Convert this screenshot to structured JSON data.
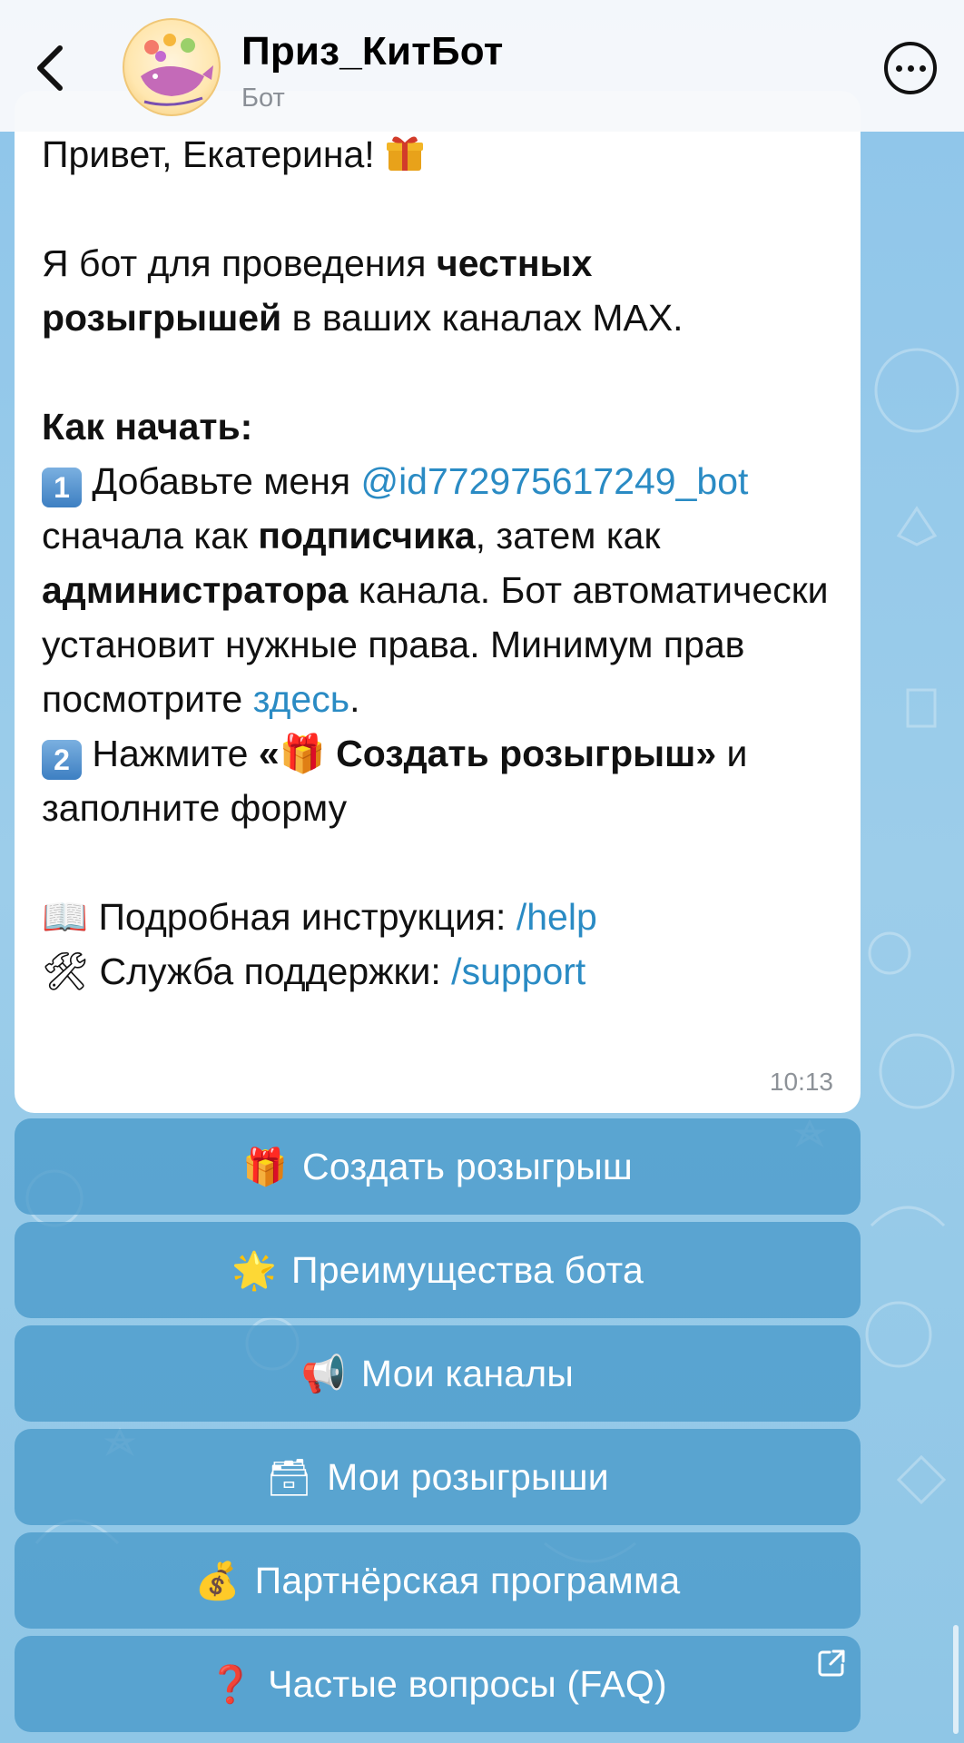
{
  "header": {
    "back_icon": "chevron-left-icon",
    "title": "Приз_КитБот",
    "subtitle": "Бот",
    "more_icon": "more-horizontal-icon"
  },
  "message": {
    "greeting": "Привет, Екатерина! ",
    "intro_pre": "Я бот для проведения ",
    "intro_bold": "честных розыгрышей",
    "intro_post": " в ваших каналах MAX.",
    "how_start": "Как начать:",
    "step1_num": "1",
    "step1_pre": " Добавьте меня ",
    "step1_link": "@id772975617249_bot",
    "step1_mid": " сначала как ",
    "step1_bold1": "подписчика",
    "step1_mid2": ", затем как ",
    "step1_bold2": "администратора",
    "step1_post": " канала. Бот автоматически установит нужные права. Минимум прав посмотрите ",
    "step1_here": "здесь",
    "step1_end": ".",
    "step2_num": "2",
    "step2_pre": " Нажмите ",
    "step2_bold": "«🎁 Создать розыгрыш»",
    "step2_post": " и заполните форму",
    "help_icon": "📖",
    "help_label": " Подробная инструкция: ",
    "help_link": "/help",
    "support_icon": "🛠",
    "support_label": " Служба поддержки: ",
    "support_link": "/support",
    "time": "10:13"
  },
  "keyboard": [
    {
      "icon": "🎁",
      "label": "Создать розыгрыш"
    },
    {
      "icon": "🌟",
      "label": "Преимущества бота"
    },
    {
      "icon": "📢",
      "label": "Мои каналы"
    },
    {
      "icon": "🗃",
      "label": "Мои розыгрыши"
    },
    {
      "icon": "💰",
      "label": "Партнёрская программа"
    },
    {
      "icon": "❓",
      "label": "Частые вопросы (FAQ)",
      "external_icon": "external-link-icon"
    }
  ],
  "colors": {
    "link": "#2a8bc4",
    "button_bg": "#4396c8",
    "wallpaper": "#93c8ea"
  }
}
